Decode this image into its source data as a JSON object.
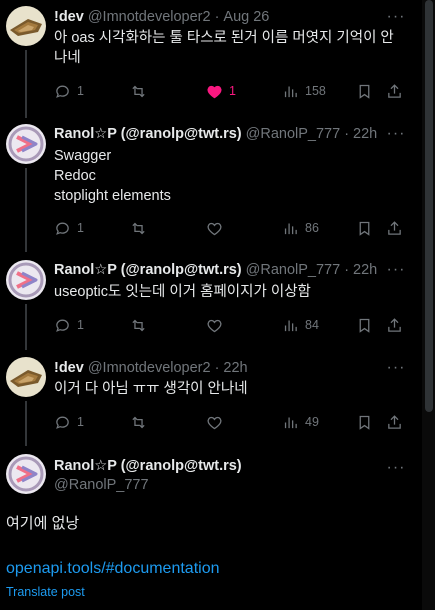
{
  "tweets": [
    {
      "name": "!dev",
      "handle": "@Imnotdeveloper2",
      "time": "Aug 26",
      "text": "아 oas 시각화하는 툴 타스로 된거 이름 머엿지 기억이 안나네",
      "replies": "1",
      "reposts": "",
      "likes": "1",
      "liked": true,
      "views": "158"
    },
    {
      "name": "Ranol☆P (@ranolp@twt.rs)",
      "handle": "@RanolP_777",
      "time": "22h",
      "text_lines": [
        "Swagger",
        "Redoc",
        "stoplight elements"
      ],
      "replies": "1",
      "reposts": "",
      "likes": "",
      "liked": false,
      "views": "86"
    },
    {
      "name": "Ranol☆P (@ranolp@twt.rs)",
      "handle": "@RanolP_777",
      "time": "22h",
      "text": "useoptic도 잇는데 이거 홈페이지가 이상함",
      "replies": "1",
      "reposts": "",
      "likes": "",
      "liked": false,
      "views": "84"
    },
    {
      "name": "!dev",
      "handle": "@Imnotdeveloper2",
      "time": "22h",
      "text": "이거 다 아님 ㅠㅠ 생각이 안나네",
      "replies": "1",
      "reposts": "",
      "likes": "",
      "liked": false,
      "views": "49"
    }
  ],
  "main": {
    "name": "Ranol☆P (@ranolp@twt.rs)",
    "handle": "@RanolP_777",
    "text": "여기에 없낭",
    "link": "openapi.tools/#documentation",
    "translate": "Translate post"
  },
  "ui": {
    "separator": "·",
    "more": "···"
  },
  "colors": {
    "background": "#000000",
    "text": "#e7e9ea",
    "muted": "#71767b",
    "link": "#1d9bf0",
    "like": "#f91880"
  },
  "icons": [
    "reply-icon",
    "repost-icon",
    "like-icon",
    "views-icon",
    "bookmark-icon",
    "share-icon",
    "more-icon"
  ]
}
